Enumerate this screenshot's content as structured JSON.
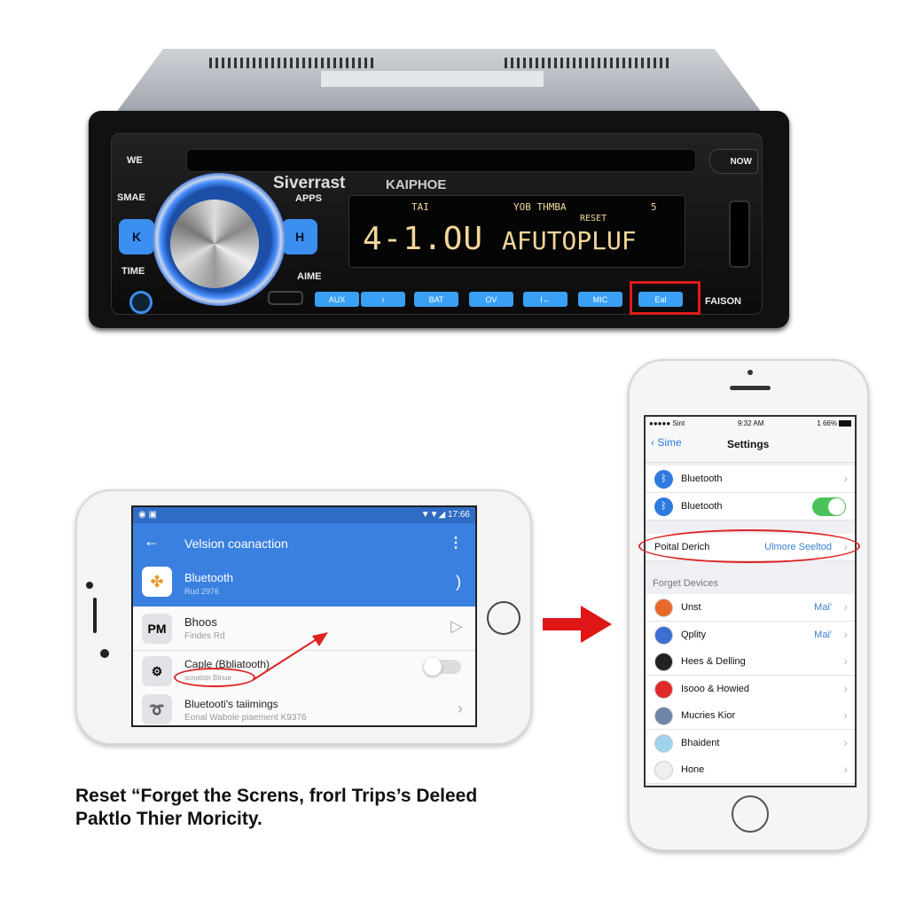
{
  "stereo": {
    "brand": "Siverrast",
    "model": "KAIPHOE",
    "labels": {
      "top_left": "WE",
      "left_mid": "SMAE",
      "left_low": "TIME",
      "apps": "APPS",
      "aime": "AIME",
      "top_right": "NOW",
      "bottom_right": "FAISON"
    },
    "side_buttons": {
      "prev": "K",
      "next": "H"
    },
    "display": {
      "top_left": "TAI",
      "top_mid": "YOB THMBA",
      "top_right": "5",
      "reset": "RESET",
      "main_left": "4-1.OU",
      "main_right": "AFUTOPLUF"
    },
    "buttons": [
      "AUX",
      "ı",
      "BAT",
      "OV",
      "I←",
      "MIC",
      "Eal"
    ],
    "highlighted_button_index": 6,
    "accent": "#3b8ff0",
    "highlight": "#e11a1a"
  },
  "android": {
    "status_time": "17:66",
    "title": "Velsion coanaction",
    "items": [
      {
        "title": "Bluetooth",
        "subtitle": "Rud 2976",
        "icon": "pinwheel-icon"
      },
      {
        "title": "Bhoos",
        "subtitle": "Findes Rd",
        "icon": "PM"
      },
      {
        "title": "Caple (Bbliatooth)",
        "subtitle": "scnotstn Btnue",
        "icon": "device-icon"
      },
      {
        "title": "Bluetooti's taiimings",
        "subtitle": "Eonal Wabole piaement K9376",
        "icon": "cable-icon"
      }
    ],
    "bar_color": "#3a80e0"
  },
  "ios": {
    "status": {
      "carrier": "●●●●● Sint",
      "time": "9:32 AM",
      "battery": "1 66%"
    },
    "back": "Sime",
    "title": "Settings",
    "bluetooth_rows": [
      "Bluetooth",
      "Bluetooth"
    ],
    "toggle_on": true,
    "highlight_row": {
      "label": "Poital Derich",
      "value": "Ulmore Seeltod"
    },
    "section": "Forget Devices",
    "devices": [
      {
        "name": "Unst",
        "value": "Mai'",
        "color": "#e86a2a"
      },
      {
        "name": "Qplity",
        "value": "Mai'",
        "color": "#3a6fd0"
      },
      {
        "name": "Hees & Delling",
        "value": "",
        "color": "#222"
      },
      {
        "name": "Isooo & Howied",
        "value": "",
        "color": "#e02a2a"
      },
      {
        "name": "Mucries Kior",
        "value": "",
        "color": "#6d86a8"
      },
      {
        "name": "Bhaident",
        "value": "",
        "color": "#9fd3ee"
      },
      {
        "name": "Hone",
        "value": "",
        "color": "#f0f0f0"
      }
    ],
    "toggle_color": "#4cc35a"
  },
  "caption": {
    "line1": "Reset “Forget the Screns, frorl  Trips’s Deleed",
    "line2": "Paktlo Thier Moricity."
  }
}
